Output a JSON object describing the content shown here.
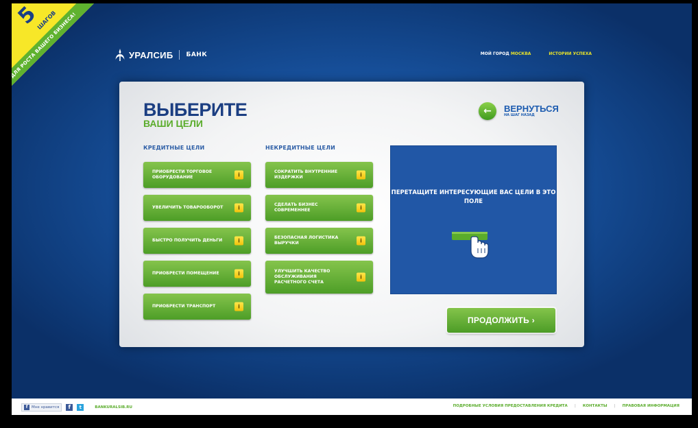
{
  "ribbon": {
    "number": "5",
    "steps": "ШАГОВ",
    "band": "ДЛЯ РОСТА ВАШЕГО БИЗНЕСА!"
  },
  "header": {
    "logo_name": "УРАЛСИБ",
    "logo_bank": "БАНК",
    "nav": {
      "city_prefix": "МОЙ ГОРОД",
      "city": "МОСКВА",
      "success": "ИСТОРИИ УСПЕХА"
    }
  },
  "main": {
    "title": "ВЫБЕРИТЕ",
    "subtitle": "ВАШИ ЦЕЛИ",
    "back": {
      "label": "ВЕРНУТЬСЯ",
      "sub": "НА ШАГ НАЗАД"
    },
    "credit": {
      "heading": "КРЕДИТНЫЕ ЦЕЛИ",
      "items": [
        {
          "label": "ПРИОБРЕСТИ ТОРГОВОЕ ОБОРУДОВАНИЕ"
        },
        {
          "label": "УВЕЛИЧИТЬ ТОВАРООБОРОТ"
        },
        {
          "label": "БЫСТРО ПОЛУЧИТЬ ДЕНЬГИ"
        },
        {
          "label": "ПРИОБРЕСТИ ПОМЕЩЕНИЕ"
        },
        {
          "label": "ПРИОБРЕСТИ ТРАНСПОРТ"
        }
      ]
    },
    "noncredit": {
      "heading": "НЕКРЕДИТНЫЕ ЦЕЛИ",
      "items": [
        {
          "label": "СОКРАТИТЬ ВНУТРЕННИЕ ИЗДЕРЖКИ"
        },
        {
          "label": "СДЕЛАТЬ БИЗНЕС СОВРЕМЕННЕЕ"
        },
        {
          "label": "БЕЗОПАСНАЯ ЛОГИСТИКА ВЫРУЧКИ"
        },
        {
          "label": "УЛУЧШИТЬ КАЧЕСТВО ОБСЛУЖИВАНИЯ РАСЧЕТНОГО СЧЕТА"
        }
      ]
    },
    "info_glyph": "i",
    "drop_text": "ПЕРЕТАЩИТЕ ИНТЕРЕСУЮЩИЕ ВАС ЦЕЛИ В ЭТО ПОЛЕ",
    "continue_label": "ПРОДОЛЖИТЬ ›"
  },
  "footer": {
    "like": "Мне нравится",
    "site": "BANKURALSIB.RU",
    "links": [
      "ПОДРОБНЫЕ УСЛОВИЯ ПРЕДОСТАВЛЕНИЯ КРЕДИТА",
      "КОНТАКТЫ",
      "ПРАВОВАЯ ИНФОРМАЦИЯ"
    ]
  },
  "colors": {
    "accent_green": "#5aac2b",
    "brand_blue": "#1b3e82",
    "bg_blue": "#1853a0",
    "ribbon_yellow": "#f7e728"
  }
}
